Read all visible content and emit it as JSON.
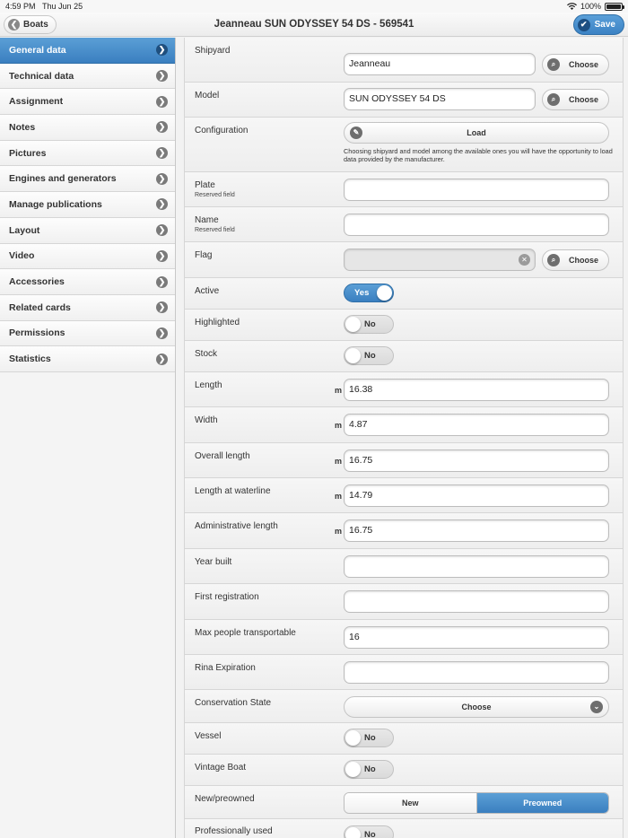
{
  "status_bar": {
    "time": "4:59 PM",
    "date": "Thu Jun 25",
    "battery": "100%"
  },
  "nav": {
    "back_label": "Boats",
    "title": "Jeanneau SUN ODYSSEY 54 DS - 569541",
    "save_label": "Save"
  },
  "sidebar": {
    "items": [
      {
        "label": "General data",
        "active": true
      },
      {
        "label": "Technical data"
      },
      {
        "label": "Assignment"
      },
      {
        "label": "Notes"
      },
      {
        "label": "Pictures"
      },
      {
        "label": "Engines and generators"
      },
      {
        "label": "Manage publications"
      },
      {
        "label": "Layout"
      },
      {
        "label": "Video"
      },
      {
        "label": "Accessories"
      },
      {
        "label": "Related cards"
      },
      {
        "label": "Permissions"
      },
      {
        "label": "Statistics"
      }
    ]
  },
  "form": {
    "shipyard": {
      "label": "Shipyard",
      "value": "Jeanneau",
      "button": "Choose"
    },
    "model": {
      "label": "Model",
      "value": "SUN ODYSSEY 54 DS",
      "button": "Choose"
    },
    "configuration": {
      "label": "Configuration",
      "button": "Load",
      "note": "Choosing shipyard and model among the available ones you will have the opportunity to load data provided by the manufacturer."
    },
    "plate": {
      "label": "Plate",
      "sublabel": "Reserved field",
      "value": ""
    },
    "name": {
      "label": "Name",
      "sublabel": "Reserved field",
      "value": ""
    },
    "flag": {
      "label": "Flag",
      "value": "",
      "button": "Choose"
    },
    "active": {
      "label": "Active",
      "value": "Yes"
    },
    "highlighted": {
      "label": "Highlighted",
      "value": "No"
    },
    "stock": {
      "label": "Stock",
      "value": "No"
    },
    "length": {
      "label": "Length",
      "unit": "m",
      "value": "16.38"
    },
    "width": {
      "label": "Width",
      "unit": "m",
      "value": "4.87"
    },
    "overall_length": {
      "label": "Overall length",
      "unit": "m",
      "value": "16.75"
    },
    "length_waterline": {
      "label": "Length at waterline",
      "unit": "m",
      "value": "14.79"
    },
    "admin_length": {
      "label": "Administrative length",
      "unit": "m",
      "value": "16.75"
    },
    "year_built": {
      "label": "Year built",
      "value": ""
    },
    "first_registration": {
      "label": "First registration",
      "value": ""
    },
    "max_people": {
      "label": "Max people transportable",
      "value": "16"
    },
    "rina_expiration": {
      "label": "Rina Expiration",
      "value": ""
    },
    "conservation_state": {
      "label": "Conservation State",
      "value": "Choose"
    },
    "vessel": {
      "label": "Vessel",
      "value": "No"
    },
    "vintage_boat": {
      "label": "Vintage Boat",
      "value": "No"
    },
    "new_preowned": {
      "label": "New/preowned",
      "options": [
        "New",
        "Preowned"
      ],
      "selected": "Preowned"
    },
    "professionally_used": {
      "label": "Professionally used",
      "value": "No"
    }
  },
  "colors": {
    "accent": "#3a7fc0",
    "accent_dark": "#2f6fa8"
  }
}
